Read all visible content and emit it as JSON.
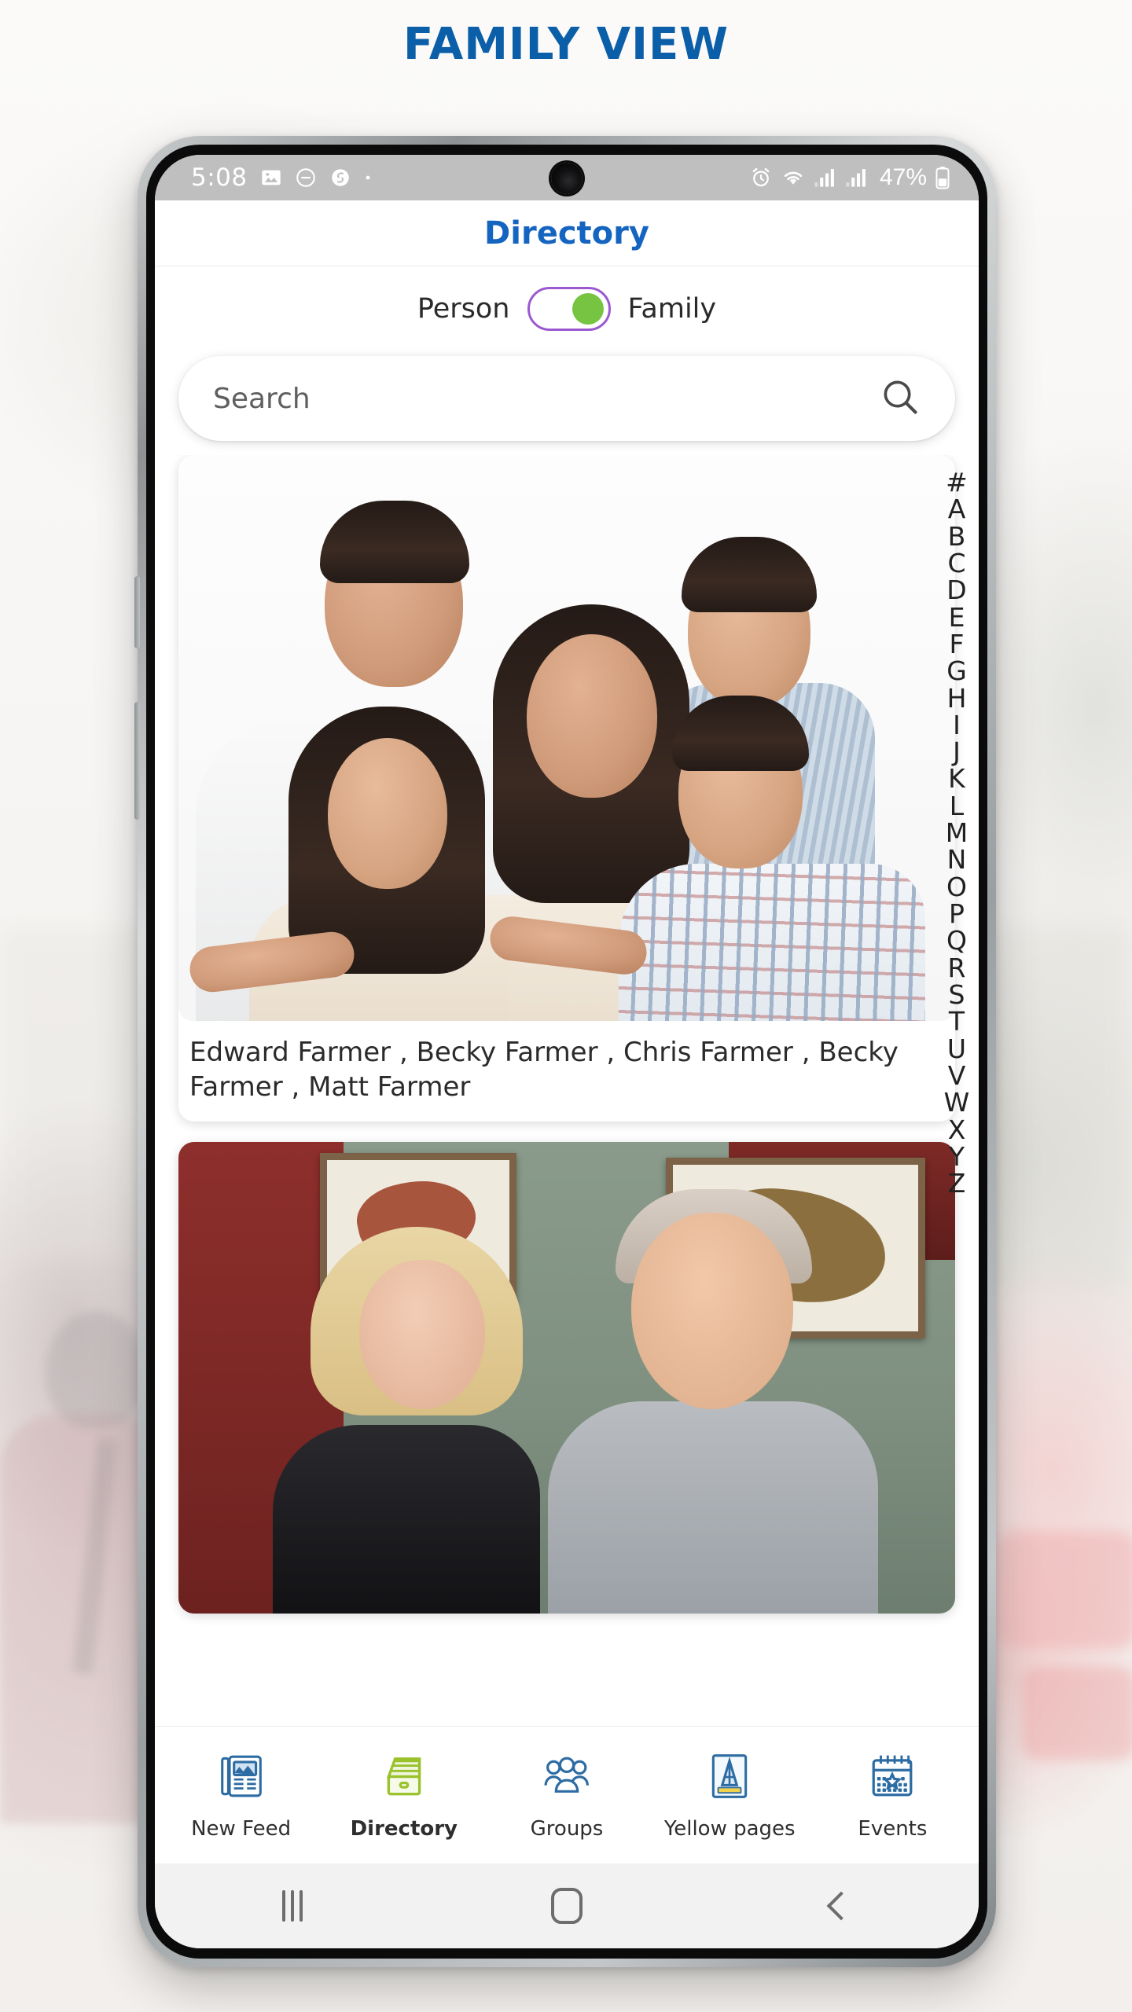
{
  "page": {
    "title": "FAMILY VIEW",
    "title_color": "#0b5ea8"
  },
  "status_bar": {
    "time": "5:08",
    "left_icons": [
      "photo-icon",
      "do-not-disturb-icon",
      "shazam-icon",
      "dot-icon"
    ],
    "right_icons": [
      "alarm-icon",
      "wifi-icon",
      "signal-icon",
      "signal-icon"
    ],
    "battery_percent": "47%"
  },
  "app_header": {
    "title": "Directory"
  },
  "toggle": {
    "left_label": "Person",
    "right_label": "Family",
    "selected": "Family",
    "border_color": "#9b59d0",
    "knob_color": "#76c442"
  },
  "search": {
    "value": "",
    "placeholder": "Search",
    "icon": "search-icon"
  },
  "alphabet_index": [
    "#",
    "A",
    "B",
    "C",
    "D",
    "E",
    "F",
    "G",
    "H",
    "I",
    "J",
    "K",
    "L",
    "M",
    "N",
    "O",
    "P",
    "Q",
    "R",
    "S",
    "T",
    "U",
    "V",
    "W",
    "X",
    "Y",
    "Z"
  ],
  "families": [
    {
      "names": "Edward Farmer , Becky Farmer , Chris Farmer , Becky Farmer , Matt Farmer",
      "photo_alt": "family-photo-farmer"
    },
    {
      "names": "",
      "photo_alt": "family-photo-couple"
    }
  ],
  "tabbar": {
    "items": [
      {
        "label": "New Feed",
        "icon": "newspaper-icon",
        "active": false
      },
      {
        "label": "Directory",
        "icon": "file-box-icon",
        "active": true
      },
      {
        "label": "Groups",
        "icon": "people-icon",
        "active": false
      },
      {
        "label": "Yellow pages",
        "icon": "yellow-pages-icon",
        "active": false
      },
      {
        "label": "Events",
        "icon": "calendar-icon",
        "active": false
      }
    ]
  },
  "android_nav": {
    "recents": "recents-icon",
    "home": "home-icon",
    "back": "back-icon"
  }
}
